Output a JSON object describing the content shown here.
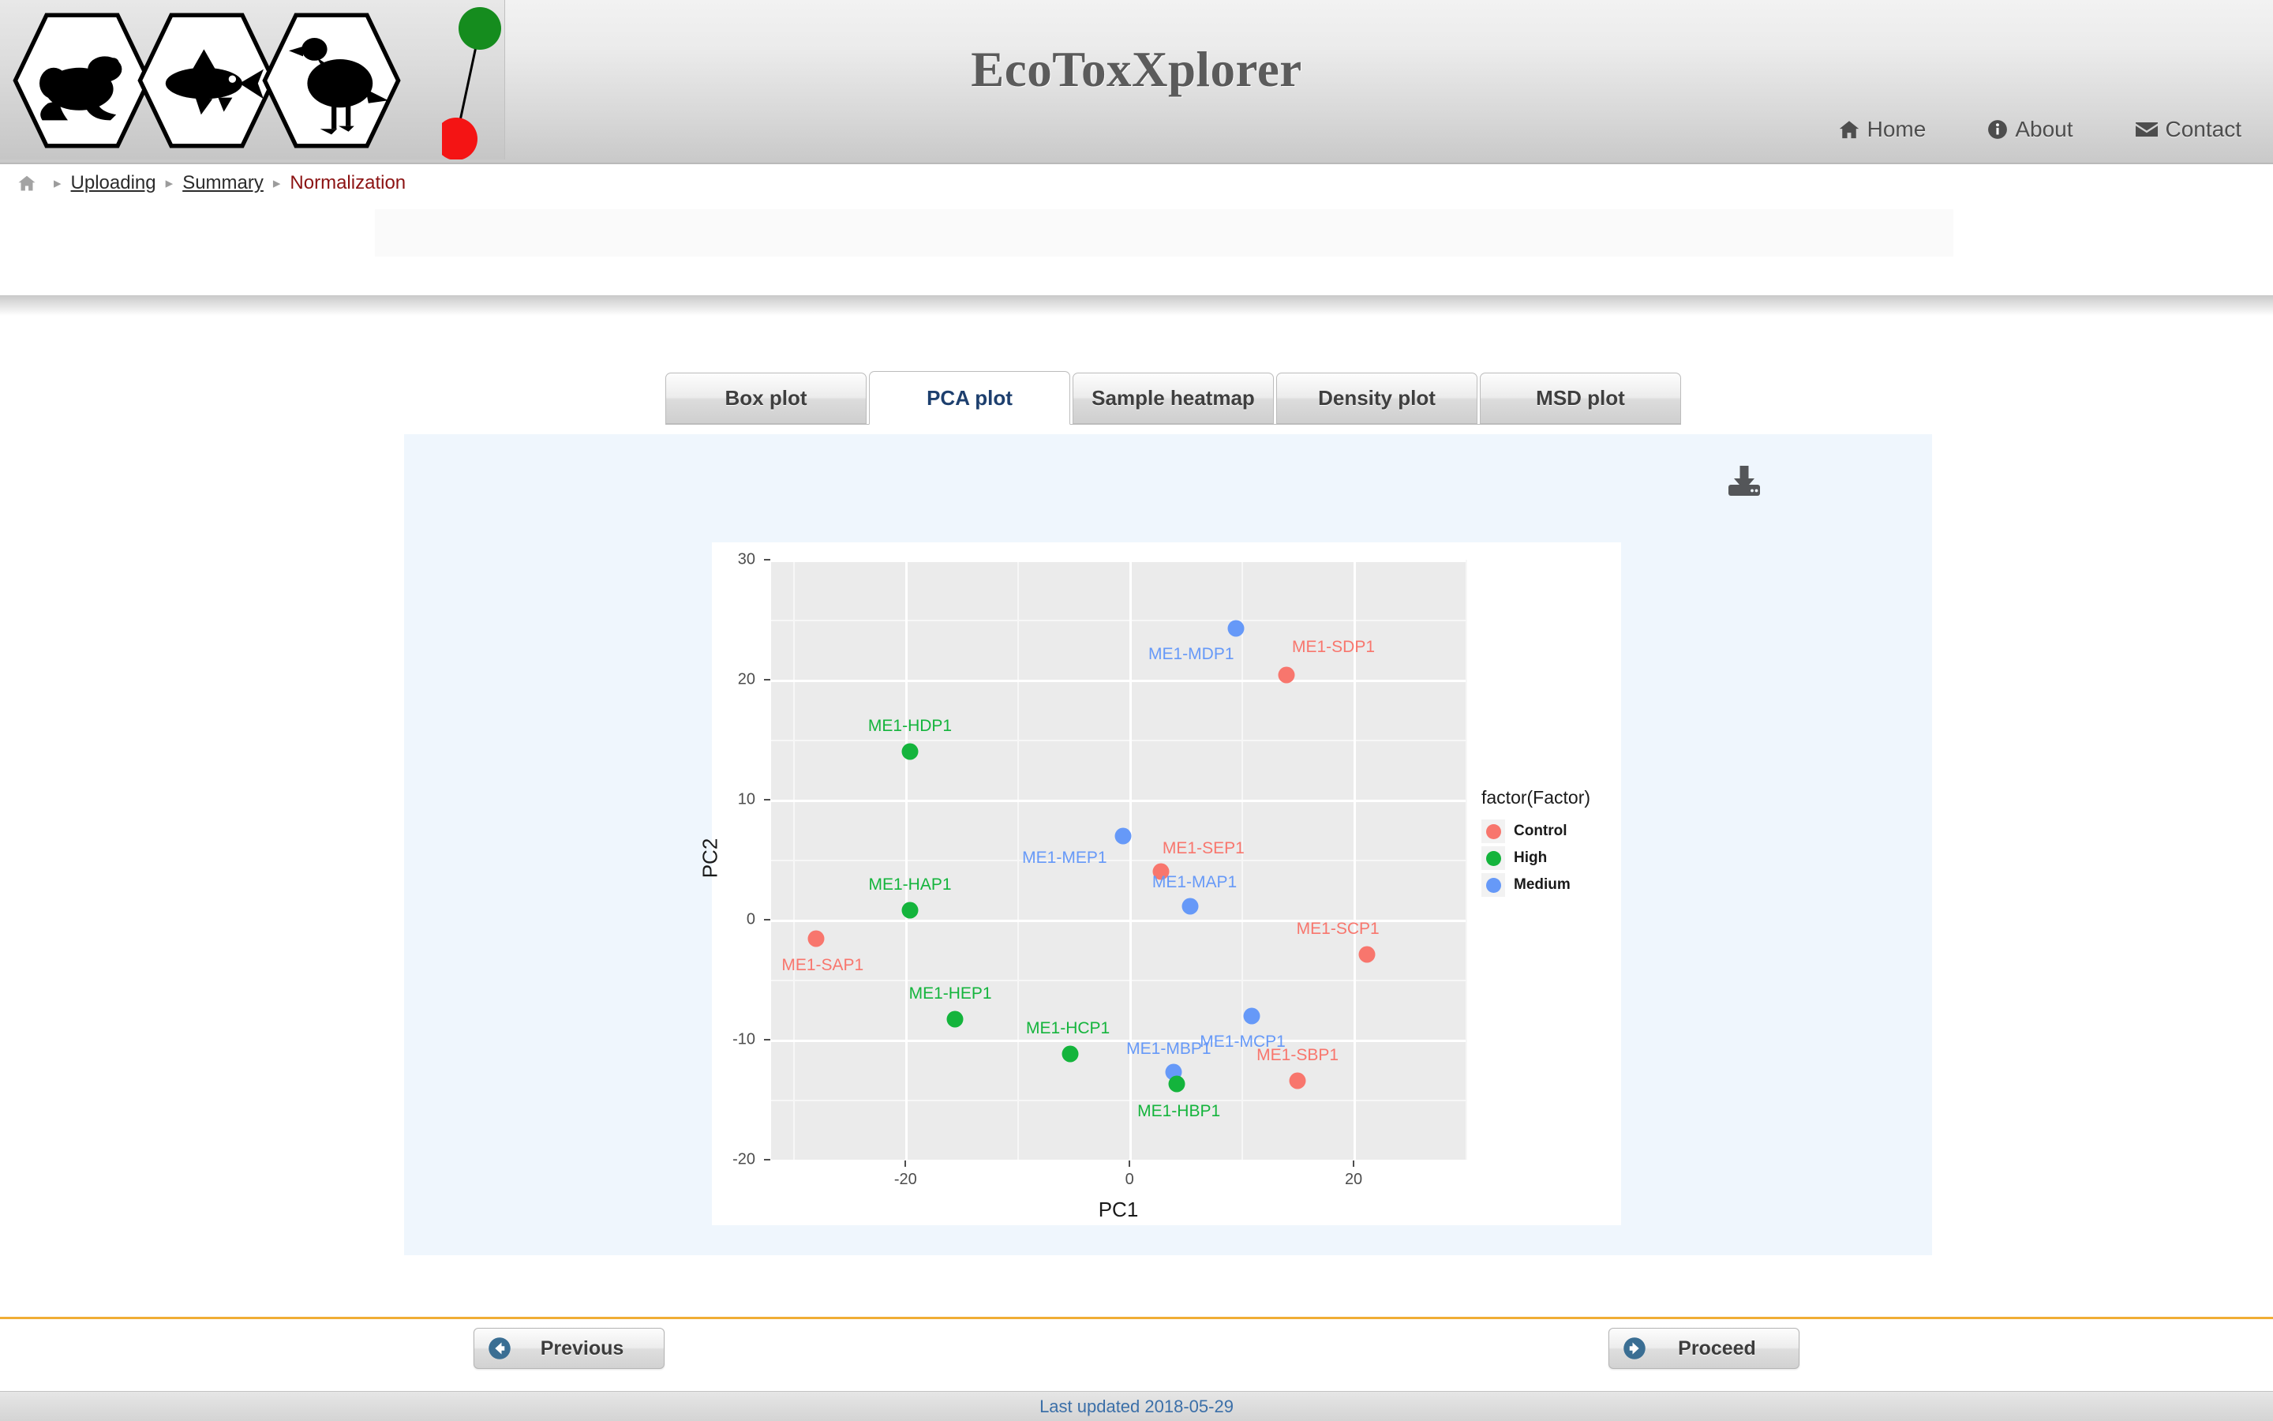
{
  "header": {
    "title": "EcoToxXplorer",
    "logo_icons": [
      "frog-hexagon",
      "fish-hexagon",
      "bird-hexagon"
    ],
    "status_dots": [
      "green-dot",
      "red-dot"
    ],
    "nav": [
      {
        "label": "Home",
        "icon": "home-icon"
      },
      {
        "label": "About",
        "icon": "info-icon"
      },
      {
        "label": "Contact",
        "icon": "envelope-icon"
      }
    ]
  },
  "breadcrumb": {
    "home_icon": "home-icon",
    "separator": "▸",
    "items": [
      {
        "label": "Uploading",
        "current": false
      },
      {
        "label": "Summary",
        "current": false
      },
      {
        "label": "Normalization",
        "current": true
      }
    ]
  },
  "tabs": [
    {
      "label": "Box plot",
      "active": false
    },
    {
      "label": "PCA plot",
      "active": true
    },
    {
      "label": "Sample heatmap",
      "active": false
    },
    {
      "label": "Density plot",
      "active": false
    },
    {
      "label": "MSD plot",
      "active": false
    }
  ],
  "toolbar": {
    "download_icon": "download-icon"
  },
  "footer_nav": {
    "previous_label": "Previous",
    "previous_icon": "arrow-circle-left-icon",
    "proceed_label": "Proceed",
    "proceed_icon": "arrow-circle-right-icon"
  },
  "footer": {
    "text": "Last updated 2018-05-29"
  },
  "colors": {
    "control": "#F8766D",
    "high": "#14B43C",
    "medium": "#6699F8",
    "panel": "#EBEBEB",
    "plot_bg": "#EFF6FD",
    "accent_rule": "#F0AD35",
    "breadcrumb_current": "#8C1313",
    "tab_active_text": "#1D3F6E"
  },
  "chart_data": {
    "type": "scatter",
    "title": "",
    "xlabel": "PC1",
    "ylabel": "PC2",
    "xlim": [
      -32,
      30
    ],
    "ylim": [
      -20,
      30
    ],
    "xticks": [
      -20,
      0,
      20
    ],
    "yticks": [
      30,
      20,
      10,
      0,
      -10,
      -20
    ],
    "grid": true,
    "legend_title": "factor(Factor)",
    "legend_position": "right",
    "legend": [
      {
        "name": "Control",
        "color": "#F8766D"
      },
      {
        "name": "High",
        "color": "#14B43C"
      },
      {
        "name": "Medium",
        "color": "#6699F8"
      }
    ],
    "points": [
      {
        "label": "ME1-MDP1",
        "x": 9.5,
        "y": 24.3,
        "group": "Medium",
        "lab_dx": -4.0,
        "lab_dy": -2.2
      },
      {
        "label": "ME1-SDP1",
        "x": 14.0,
        "y": 20.4,
        "group": "Control",
        "lab_dx": 4.2,
        "lab_dy": 2.3
      },
      {
        "label": "ME1-HDP1",
        "x": -19.6,
        "y": 14.0,
        "group": "High",
        "lab_dx": 0.0,
        "lab_dy": 2.1
      },
      {
        "label": "ME1-MEP1",
        "x": -0.6,
        "y": 7.0,
        "group": "Medium",
        "lab_dx": -5.2,
        "lab_dy": -1.9
      },
      {
        "label": "ME1-SEP1",
        "x": 2.8,
        "y": 4.0,
        "group": "Control",
        "lab_dx": 3.8,
        "lab_dy": 1.9
      },
      {
        "label": "ME1-MAP1",
        "x": 5.4,
        "y": 1.1,
        "group": "Medium",
        "lab_dx": 0.4,
        "lab_dy": 2.0
      },
      {
        "label": "ME1-HAP1",
        "x": -19.6,
        "y": 0.8,
        "group": "High",
        "lab_dx": 0.0,
        "lab_dy": 2.1
      },
      {
        "label": "ME1-SAP1",
        "x": -28.0,
        "y": -1.6,
        "group": "Control",
        "lab_dx": 0.6,
        "lab_dy": -2.2
      },
      {
        "label": "ME1-SCP1",
        "x": 21.2,
        "y": -2.9,
        "group": "Control",
        "lab_dx": -2.6,
        "lab_dy": 2.1
      },
      {
        "label": "ME1-HEP1",
        "x": -15.6,
        "y": -8.3,
        "group": "High",
        "lab_dx": -0.4,
        "lab_dy": 2.1
      },
      {
        "label": "ME1-MCP1",
        "x": 10.9,
        "y": -8.0,
        "group": "Medium",
        "lab_dx": -0.8,
        "lab_dy": -2.2
      },
      {
        "label": "ME1-HCP1",
        "x": -5.3,
        "y": -11.2,
        "group": "High",
        "lab_dx": -0.2,
        "lab_dy": 2.1
      },
      {
        "label": "ME1-MBP1",
        "x": 3.9,
        "y": -12.7,
        "group": "Medium",
        "lab_dx": -0.4,
        "lab_dy": 1.9
      },
      {
        "label": "ME1-HBP1",
        "x": 4.2,
        "y": -13.7,
        "group": "High",
        "lab_dx": 0.2,
        "lab_dy": -2.3
      },
      {
        "label": "ME1-SBP1",
        "x": 15.0,
        "y": -13.4,
        "group": "Control",
        "lab_dx": 0.0,
        "lab_dy": 2.1
      }
    ]
  }
}
